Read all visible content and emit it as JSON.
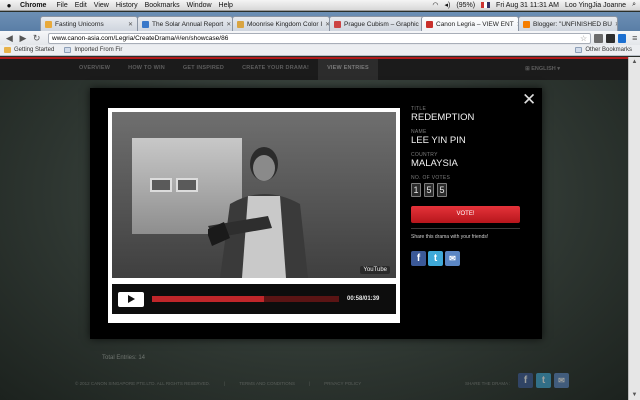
{
  "menubar": {
    "apple": "",
    "items": [
      "Chrome",
      "File",
      "Edit",
      "View",
      "History",
      "Bookmarks",
      "Window",
      "Help"
    ],
    "battery": "(95%)",
    "clock": "Fri Aug 31  11:31 AM",
    "user": "Loo YingJia Joanne"
  },
  "tabs": [
    {
      "label": "Fasting Unicorns",
      "color": "#e8a93a"
    },
    {
      "label": "The Solar Annual Report",
      "color": "#3a78c9"
    },
    {
      "label": "Moonrise Kingdom Color I",
      "color": "#d9a441"
    },
    {
      "label": "Prague Cubism – Graphic",
      "color": "#cc4444"
    },
    {
      "label": "Canon Legria – VIEW ENT",
      "color": "#c9302c"
    },
    {
      "label": "Blogger: \"UNFINISHED BU",
      "color": "#f57d00"
    }
  ],
  "toolbar": {
    "url": "www.canon-asia.com/Legria/CreateDrama/#/en/showcase/86",
    "back": "◀",
    "forward": "▶",
    "reload": "↻",
    "star": "☆"
  },
  "bookmarks": {
    "getting_started": "Getting Started",
    "imported": "Imported From Fir",
    "other": "Other Bookmarks"
  },
  "site": {
    "nav": [
      "OVERVIEW",
      "HOW TO WIN",
      "GET INSPIRED",
      "CREATE YOUR DRAMA!",
      "VIEW ENTRIES"
    ],
    "lang": "⊞ ENGLISH ▾",
    "total_entries": "Total Entries: 14",
    "footer": [
      "© 2012 CANON SINGAPORE PTE.LTD. ALL RIGHTS RESERVED.",
      "|",
      "TERMS AND CONDITIONS",
      "|",
      "PRIVACY POLICY"
    ],
    "share_footer": "SHARE THE DRAMA :"
  },
  "modal": {
    "close": "✕",
    "video": {
      "youtube": "YouTube",
      "time": "00:58/01:39",
      "progress": 0.6
    },
    "title_label": "TITLE",
    "title": "REDEMPTION",
    "name_label": "NAME",
    "name": "LEE YIN PIN",
    "country_label": "COUNTRY",
    "country": "MALAYSIA",
    "votes_label": "NO. OF VOTES",
    "votes": [
      "1",
      "5",
      "5"
    ],
    "vote_button": "VOTE!",
    "share_text": "Share this drama with your friends!",
    "social": {
      "facebook": "f",
      "twitter": "t",
      "email": "✉"
    }
  }
}
